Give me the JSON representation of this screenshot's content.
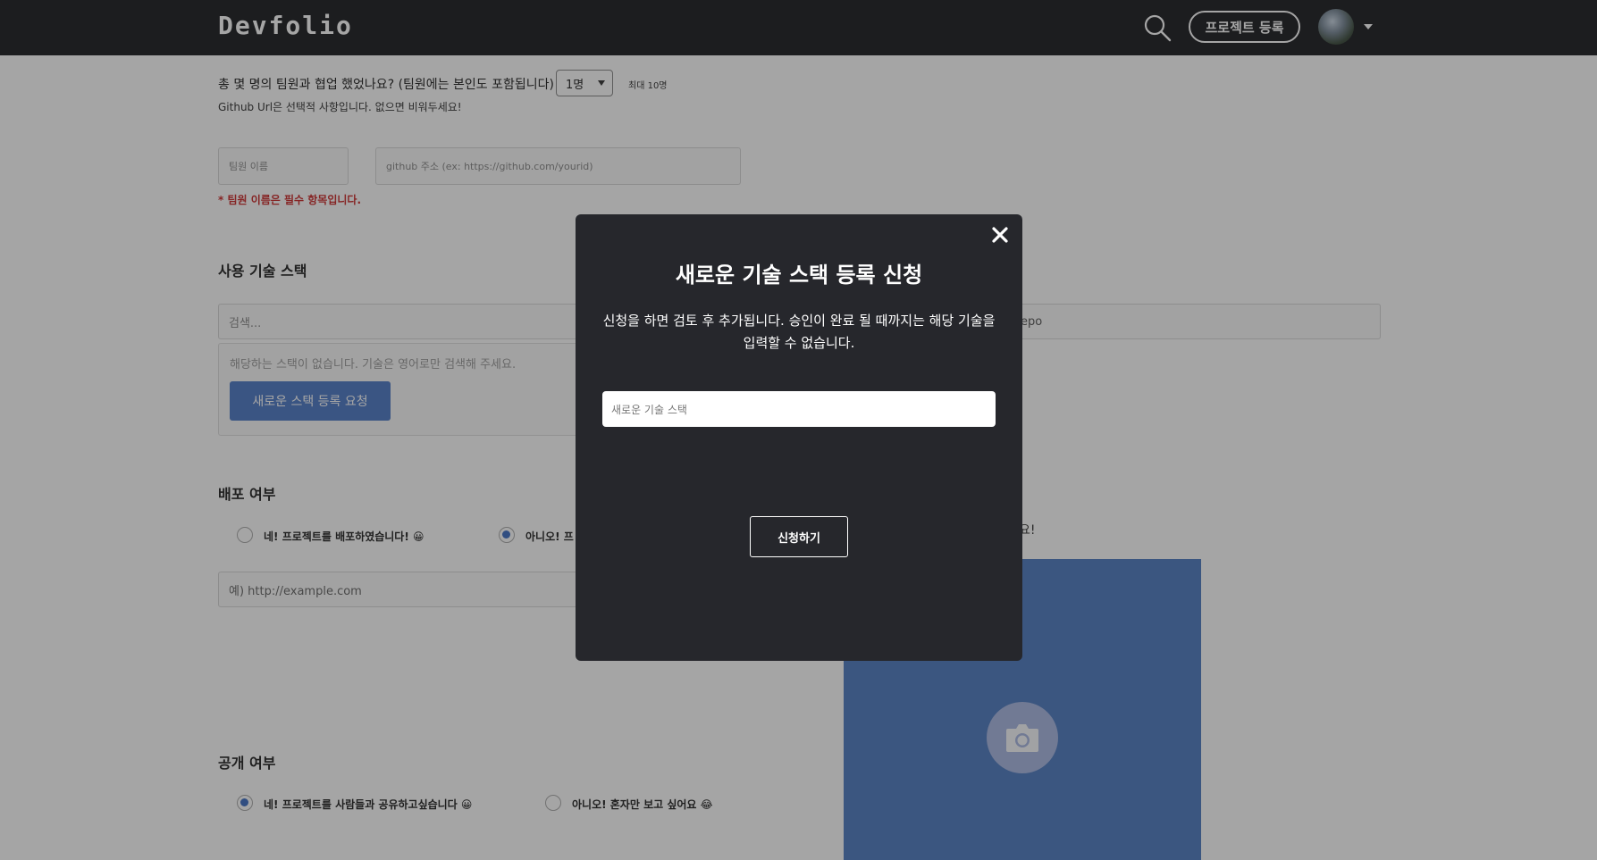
{
  "header": {
    "logo": "Devfolio",
    "register_label": "프로젝트 등록"
  },
  "team": {
    "question": "총 몇 명의 팀원과 협업 했었나요? (팀원에는 본인도 포함됩니다)",
    "selected_count": "1명",
    "max_note": "최대 10명",
    "github_note": "Github Url은 선택적 사항입니다. 없으면 비워두세요!",
    "name_placeholder": "팀원 이름",
    "github_placeholder": "github 주소 (ex: https://github.com/yourid)",
    "required_msg": "* 팀원 이름은 필수 항목입니다."
  },
  "stack": {
    "title": "사용 기술 스택",
    "search_placeholder": "검색...",
    "empty_msg": "해당하는 스택이 없습니다. 기술은 영어로만 검색해 주세요.",
    "new_stack_button": "새로운 스택 등록 요청",
    "repo_visible_fragment": "epo"
  },
  "deploy": {
    "title": "배포 여부",
    "option_yes": "네! 프로젝트를 배포하였습니다! 😀",
    "option_no": "아니오! 프",
    "url_placeholder": "예) http://example.com",
    "thumbnail_hint_fragment": "요!"
  },
  "public": {
    "title": "공개 여부",
    "option_yes": "네! 프로젝트를 사람들과 공유하고싶습니다 😀",
    "option_no": "아니오! 혼자만 보고 싶어요 😂"
  },
  "modal": {
    "title": "새로운 기술 스택 등록 신청",
    "description": "신청을 하면 검토 후 추가됩니다. 승인이 완료 될 때까지는 해당 기술을 입력할 수 없습니다.",
    "input_placeholder": "새로운 기술 스택",
    "submit_label": "신청하기"
  },
  "colors": {
    "header_bg": "#1c1d21",
    "accent": "#4e7ac7",
    "modal_bg": "#26272c",
    "error": "#cc2a2a"
  },
  "icons": {
    "search": "search-icon",
    "close": "close-icon",
    "camera": "camera-icon",
    "caret": "caret-down-icon"
  }
}
